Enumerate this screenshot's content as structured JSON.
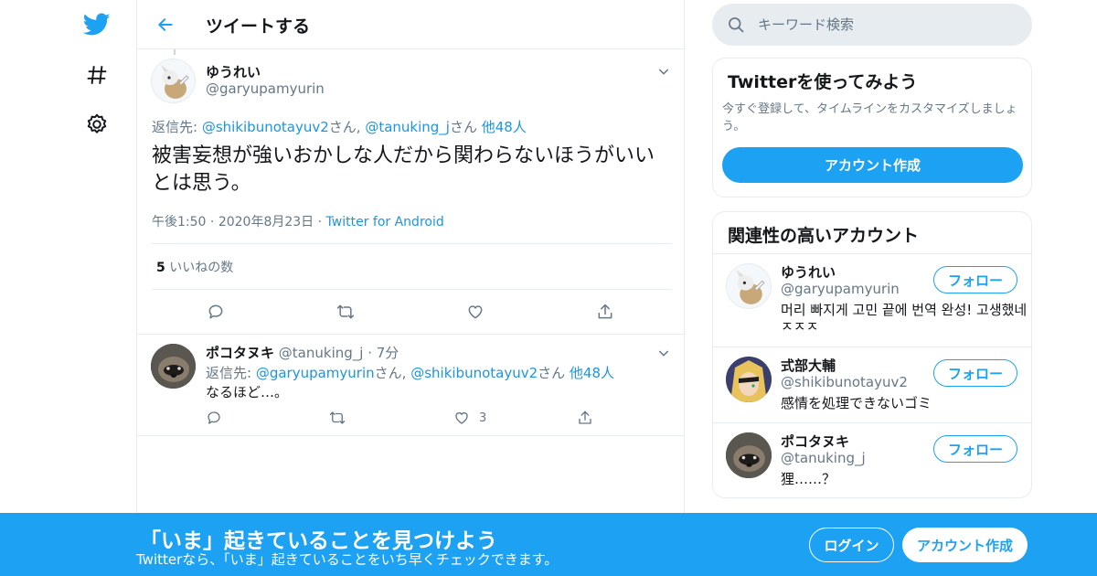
{
  "header": {
    "title": "ツイートする"
  },
  "nav": {
    "icons": [
      "twitter-bird-icon",
      "hashtag-icon",
      "gear-icon"
    ]
  },
  "main_tweet": {
    "name": "ゆうれい",
    "handle": "@garyupamyurin",
    "reply_prefix": "返信先: ",
    "reply_user1": "@shikibunotayuv2",
    "reply_san1": "さん, ",
    "reply_user2": "@tanuking_j",
    "reply_san2": "さん ",
    "reply_others": "他48人",
    "text": "被害妄想が強いおかしな人だから関わらないほうがいいとは思う。",
    "time": "午後1:50",
    "date": "2020年8月23日",
    "source": "Twitter for Android",
    "like_count": "5",
    "like_label": " いいねの数"
  },
  "reply_tweet": {
    "name": "ポコタヌキ",
    "handle": "@tanuking_j",
    "time": "7分",
    "reply_prefix": "返信先: ",
    "reply_user1": "@garyupamyurin",
    "reply_san1": "さん, ",
    "reply_user2": "@shikibunotayuv2",
    "reply_san2": "さん ",
    "reply_others": "他48人",
    "text": "なるほど…。",
    "like_count": "3"
  },
  "search": {
    "placeholder": "キーワード検索"
  },
  "signup_card": {
    "title": "Twitterを使ってみよう",
    "description": "今すぐ登録して、タイムラインをカスタマイズしましょう。",
    "button": "アカウント作成"
  },
  "related": {
    "title": "関連性の高いアカウント",
    "follow_label": "フォロー",
    "accounts": [
      {
        "name": "ゆうれい",
        "handle": "@garyupamyurin",
        "bio": "머리 빠지게 고민 끝에 번역 완성! 고생했네 ㅈㅈㅈ"
      },
      {
        "name": "式部大輔",
        "handle": "@shikibunotayuv2",
        "bio": "感情を処理できないゴミ"
      },
      {
        "name": "ポコタヌキ",
        "handle": "@tanuking_j",
        "bio": "狸……？"
      }
    ]
  },
  "bottom_bar": {
    "title": "「いま」起きていることを見つけよう",
    "subtitle": "Twitterなら、「いま」起きていることをいち早くチェックできます。",
    "login": "ログイン",
    "signup": "アカウント作成"
  },
  "colors": {
    "accent": "#1da1f2",
    "link": "#1b95e0",
    "muted": "#657786",
    "border": "#e6ecf0"
  }
}
